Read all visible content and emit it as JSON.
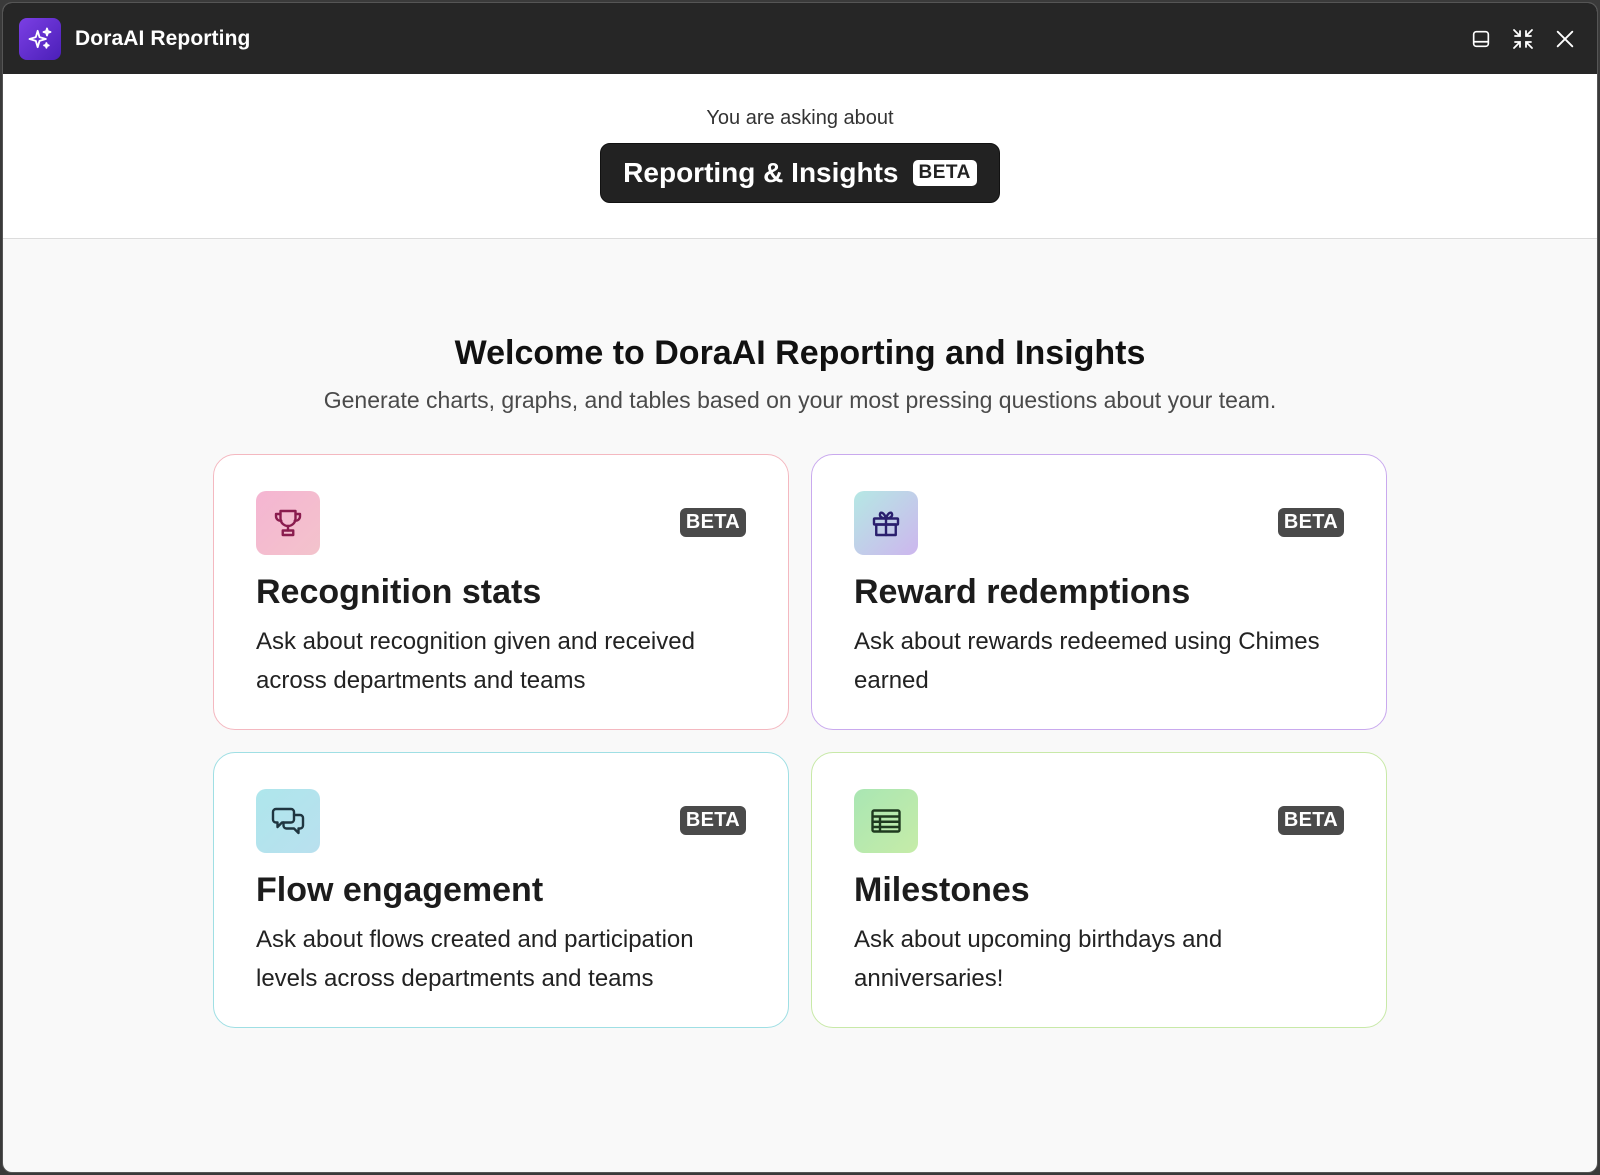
{
  "window": {
    "title": "DoraAI Reporting",
    "logo_icon": "sparkles-icon",
    "controls": [
      "minimize-icon",
      "collapse-icon",
      "close-icon"
    ]
  },
  "context": {
    "asking_label": "You are asking about",
    "topic": "Reporting & Insights",
    "badge": "BETA"
  },
  "welcome": {
    "title": "Welcome to DoraAI Reporting and Insights",
    "subtitle": "Generate charts, graphs, and tables based on your most pressing questions about your team."
  },
  "cards": [
    {
      "title": "Recognition stats",
      "description": "Ask about recognition given and received across departments and teams",
      "badge": "BETA",
      "icon": "trophy-icon",
      "accent": "#f4b8c0"
    },
    {
      "title": "Reward redemptions",
      "description": "Ask about rewards redeemed using Chimes earned",
      "badge": "BETA",
      "icon": "gift-icon",
      "accent": "#c9a9ee"
    },
    {
      "title": "Flow engagement",
      "description": "Ask about flows created and participation levels across departments and teams",
      "badge": "BETA",
      "icon": "chat-bubbles-icon",
      "accent": "#9fdfe4"
    },
    {
      "title": "Milestones",
      "description": "Ask about upcoming birthdays and anniversaries!",
      "badge": "BETA",
      "icon": "table-icon",
      "accent": "#c8e9a8"
    }
  ]
}
